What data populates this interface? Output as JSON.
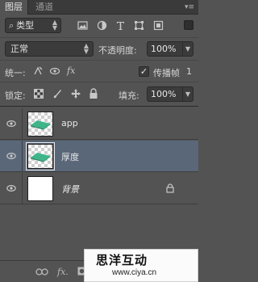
{
  "tabs": [
    {
      "label": "图层",
      "active": true
    },
    {
      "label": "通道",
      "active": false
    }
  ],
  "filter": {
    "kind_label": "类型",
    "icons": [
      "image-filter-icon",
      "adjustment-filter-icon",
      "type-filter-icon",
      "shape-filter-icon",
      "smart-object-filter-icon"
    ]
  },
  "blend": {
    "mode": "正常",
    "opacity_label": "不透明度:",
    "opacity_value": "100%"
  },
  "unify": {
    "label": "统一:",
    "propagate_label": "传播帧",
    "propagate_checked": true,
    "frame_number": "1"
  },
  "lock": {
    "label": "锁定:",
    "fill_label": "填充:",
    "fill_value": "100%"
  },
  "layers": [
    {
      "name": "app",
      "visible": true,
      "selected": false,
      "italic": false,
      "locked": false,
      "thumb": "art"
    },
    {
      "name": "厚度",
      "visible": true,
      "selected": true,
      "italic": false,
      "locked": false,
      "thumb": "art"
    },
    {
      "name": "背景",
      "visible": true,
      "selected": false,
      "italic": true,
      "locked": true,
      "thumb": "white"
    }
  ],
  "bottom_icons": [
    "link-icon",
    "fx-icon",
    "mask-icon"
  ],
  "watermark": {
    "title": "思洋互动",
    "url": "www.ciya.cn"
  },
  "colors": {
    "panel": "#535353",
    "selected_row": "#5a6779",
    "thumb_accent": "#3fb58a"
  }
}
